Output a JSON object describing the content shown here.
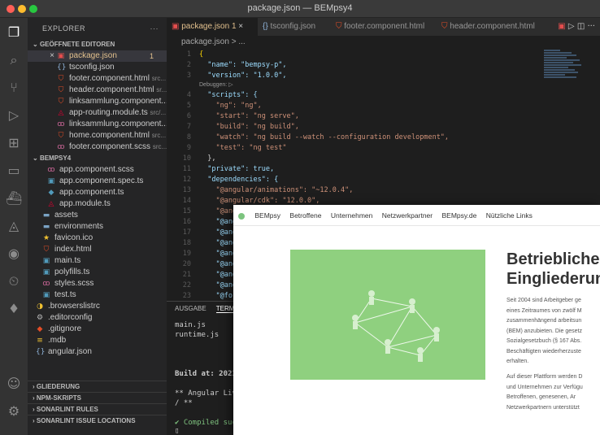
{
  "window": {
    "title": "package.json — BEMpsy4"
  },
  "sidebar": {
    "header": "EXPLORER",
    "open_editors_title": "GEÖFFNETE EDITOREN",
    "open_editors": [
      {
        "name": "package.json",
        "badge": "1",
        "icon": "json"
      },
      {
        "name": "tsconfig.json",
        "icon": "braces"
      },
      {
        "name": "footer.component.html",
        "path": "src...",
        "icon": "html"
      },
      {
        "name": "header.component.html",
        "path": "sr...",
        "icon": "html"
      },
      {
        "name": "linksammlung.component....",
        "icon": "html"
      },
      {
        "name": "app-routing.module.ts",
        "path": "src/...",
        "icon": "angular"
      },
      {
        "name": "linksammlung.component....",
        "icon": "scss"
      },
      {
        "name": "home.component.html",
        "path": "src...",
        "icon": "html"
      },
      {
        "name": "footer.component.scss",
        "path": "src...",
        "icon": "scss"
      }
    ],
    "project_title": "BEMPSY4",
    "project_files": [
      {
        "name": "app.component.scss",
        "icon": "scss"
      },
      {
        "name": "app.component.spec.ts",
        "icon": "ts"
      },
      {
        "name": "app.component.ts",
        "icon": "ts"
      },
      {
        "name": "app.module.ts",
        "icon": "angular"
      },
      {
        "name": "assets",
        "icon": "folder"
      },
      {
        "name": "environments",
        "icon": "folder"
      },
      {
        "name": "favicon.ico",
        "icon": "star"
      },
      {
        "name": "index.html",
        "icon": "html"
      },
      {
        "name": "main.ts",
        "icon": "ts"
      },
      {
        "name": "polyfills.ts",
        "icon": "ts"
      },
      {
        "name": "styles.scss",
        "icon": "scss"
      },
      {
        "name": "test.ts",
        "icon": "ts"
      },
      {
        "name": ".browserslistrc",
        "icon": "config"
      },
      {
        "name": ".editorconfig",
        "icon": "gear"
      },
      {
        "name": ".gitignore",
        "icon": "git"
      },
      {
        "name": ".mdb",
        "icon": "db"
      },
      {
        "name": "angular.json",
        "icon": "braces"
      }
    ],
    "bottom_sections": [
      "GLIEDERUNG",
      "NPM-SKRIPTS",
      "SONARLINT RULES",
      "SONARLINT ISSUE LOCATIONS"
    ]
  },
  "tabs": [
    {
      "label": "package.json 1",
      "active": true
    },
    {
      "label": "tsconfig.json"
    },
    {
      "label": "footer.component.html"
    },
    {
      "label": "header.component.html"
    }
  ],
  "breadcrumb": "package.json > ...",
  "editor": {
    "lines": [
      {
        "n": "1",
        "text": "{"
      },
      {
        "n": "2",
        "text": "  \"name\": \"bempsy-p\","
      },
      {
        "n": "3",
        "text": "  \"version\": \"1.0.0\","
      },
      {
        "n": "",
        "text": "Debuggen: ▷"
      },
      {
        "n": "4",
        "text": "  \"scripts\": {"
      },
      {
        "n": "5",
        "text": "    \"ng\": \"ng\","
      },
      {
        "n": "6",
        "text": "    \"start\": \"ng serve\","
      },
      {
        "n": "7",
        "text": "    \"build\": \"ng build\","
      },
      {
        "n": "8",
        "text": "    \"watch\": \"ng build --watch --configuration development\","
      },
      {
        "n": "9",
        "text": "    \"test\": \"ng test\""
      },
      {
        "n": "10",
        "text": "  },"
      },
      {
        "n": "11",
        "text": "  \"private\": true,"
      },
      {
        "n": "12",
        "text": "  \"dependencies\": {"
      },
      {
        "n": "13",
        "text": "    \"@angular/animations\": \"~12.0.4\","
      },
      {
        "n": "14",
        "text": "    \"@angular/cdk\": \"12.0.0\","
      },
      {
        "n": "15",
        "text": "    \"@angular/common\": \"~12.0.4\","
      },
      {
        "n": "16",
        "text": "    \"@ang"
      },
      {
        "n": "17",
        "text": "    \"@ang"
      },
      {
        "n": "18",
        "text": "    \"@ang"
      },
      {
        "n": "19",
        "text": "    \"@ang"
      },
      {
        "n": "20",
        "text": "    \"@ang"
      },
      {
        "n": "21",
        "text": "    \"@ang"
      },
      {
        "n": "22",
        "text": "    \"@ang"
      },
      {
        "n": "23",
        "text": "    \"@for"
      },
      {
        "n": "24",
        "text": "    \"@for"
      },
      {
        "n": "25",
        "text": "    \"@for"
      }
    ]
  },
  "terminal": {
    "tabs": [
      "AUSGABE",
      "TERM"
    ],
    "lines": [
      "main.js",
      "runtime.js",
      "",
      "",
      "",
      "Build at: 2021-(",
      "",
      "** Angular Live",
      "/ **",
      "",
      "",
      "✔ Compiled succe",
      "▯"
    ]
  },
  "browser": {
    "nav": [
      "BEMpsy",
      "Betroffene",
      "Unternehmen",
      "Netzwerkpartner",
      "BEMpsy.de",
      "Nützliche Links"
    ],
    "heading_line1": "Betriebliche",
    "heading_line2": "Eingliederun",
    "para1": [
      "Seit 2004 sind Arbeitgeber ge",
      "eines Zeitraumes von zwölf M",
      "zusammenhängend arbeitsun",
      "(BEM) anzubieten. Die gesetz",
      "Sozialgesetzbuch (§ 167 Abs.",
      "Beschäftigten wiederherzuste",
      "erhalten."
    ],
    "para2": [
      "Auf dieser Plattform werden D",
      "und Unternehmen zur Verfügu",
      "Betroffenen, genesenen, Ar",
      "Netzwerkpartnern unterstützt"
    ]
  }
}
